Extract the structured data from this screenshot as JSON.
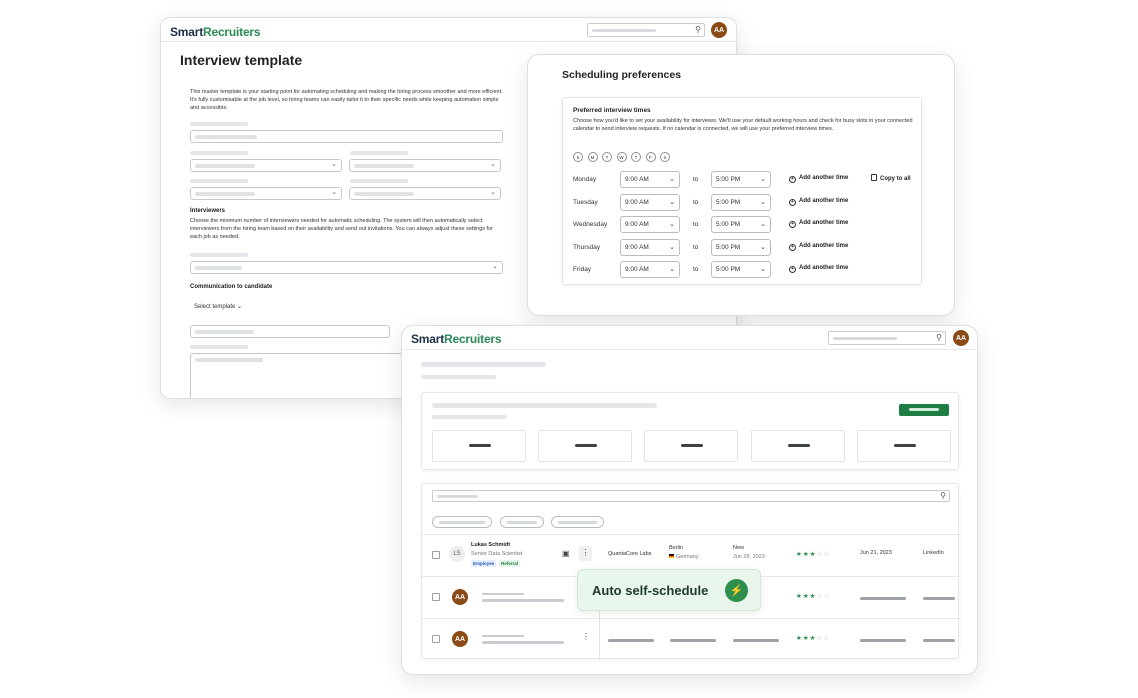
{
  "brand": {
    "part1": "Smart",
    "part2": "Recruiters"
  },
  "user": {
    "initials": "AA"
  },
  "template_window": {
    "title": "Interview template",
    "intro": "This master template is your starting point for automating scheduling and making the hiring process smoother and more efficient. It's fully customisable at the job level, so hiring teams can easily tailor it to their specific needs while keeping automation simple and accessible.",
    "interviewers_heading": "Interviewers",
    "interviewers_text": "Choose the minimum number of interviewers needed for automatic scheduling. The system will then automatically select interviewers from the hiring team based on their availability and send out invitations. You can always adjust these settings for each job as needed.",
    "communication_heading": "Communication to candidate",
    "select_template": "Select template"
  },
  "scheduling_window": {
    "title": "Scheduling preferences",
    "section_title": "Preferred interview times",
    "description": "Choose how you'd like to set your availability for interviews. We'll use your default working hours and check for busy slots in your connected calendar to send interview requests. If no calendar is connected, we will use your preferred interview times.",
    "day_chips": [
      "S",
      "M",
      "T",
      "W",
      "T",
      "F",
      "S"
    ],
    "to_label": "to",
    "add_label": "Add another time",
    "copy_label": "Copy to all",
    "rows": [
      {
        "day": "Monday",
        "start": "9:00 AM",
        "end": "5:00 PM"
      },
      {
        "day": "Tuesday",
        "start": "9:00 AM",
        "end": "5:00 PM"
      },
      {
        "day": "Wednesday",
        "start": "9:00 AM",
        "end": "5:00 PM"
      },
      {
        "day": "Thursday",
        "start": "9:00 AM",
        "end": "5:00 PM"
      },
      {
        "day": "Friday",
        "start": "9:00 AM",
        "end": "5:00 PM"
      }
    ]
  },
  "candidates_window": {
    "candidate": {
      "initials": "LS",
      "name": "Lukas Schmidt",
      "role": "Senior Data Scientist",
      "tags": [
        "Employee",
        "Referral"
      ],
      "company": "QuantaCore Labs",
      "city": "Berlin",
      "country": "Germany",
      "status": "New",
      "status_date": "Jun 28, 2023",
      "rating": 3,
      "applied": "Jun 21, 2023",
      "source": "LinkedIn"
    },
    "other_ratings": [
      3,
      3
    ],
    "toast": "Auto self-schedule"
  },
  "colors": {
    "brand_green": "#2a8a56",
    "brand_navy": "#1c2e4a",
    "accent": "#1e7d44",
    "avatar": "#8a4a16"
  }
}
